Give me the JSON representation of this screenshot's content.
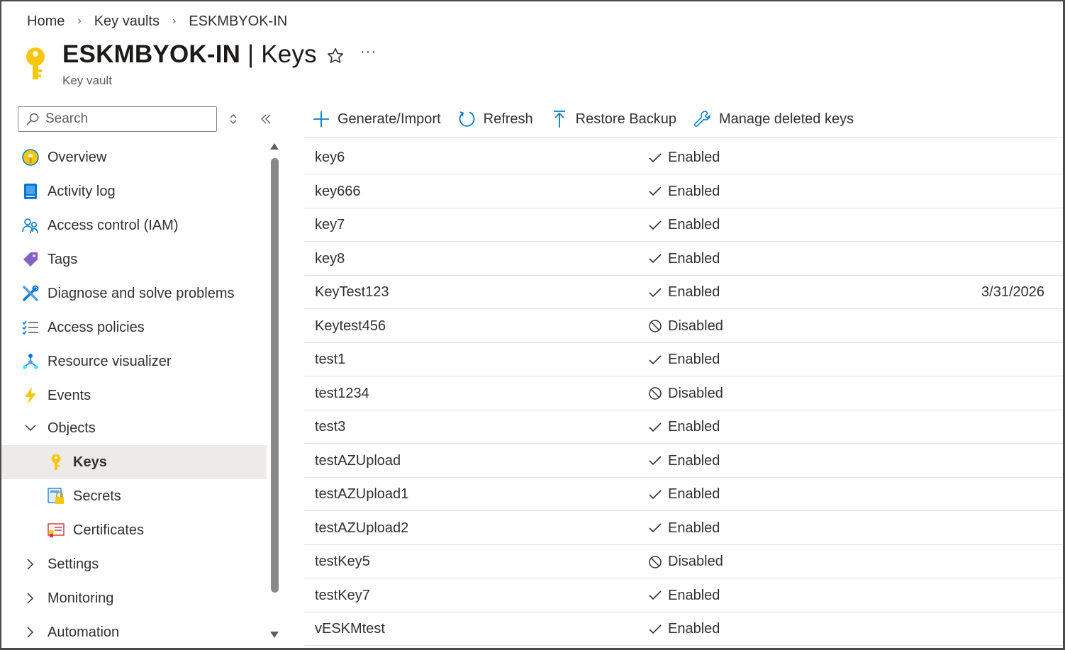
{
  "breadcrumb": [
    {
      "label": "Home"
    },
    {
      "label": "Key vaults"
    },
    {
      "label": "ESKMBYOK-IN"
    }
  ],
  "header": {
    "title_resource": "ESKMBYOK-IN",
    "title_separator": " | ",
    "title_section": "Keys",
    "subtitle": "Key vault",
    "favorite_icon": "star-outline-icon",
    "more_label": "···"
  },
  "nav": {
    "search_placeholder": "Search",
    "items": [
      {
        "label": "Overview",
        "icon": "overview-icon"
      },
      {
        "label": "Activity log",
        "icon": "activity-log-icon"
      },
      {
        "label": "Access control (IAM)",
        "icon": "iam-icon"
      },
      {
        "label": "Tags",
        "icon": "tag-icon"
      },
      {
        "label": "Diagnose and solve problems",
        "icon": "wrench-icon"
      },
      {
        "label": "Access policies",
        "icon": "checklist-icon"
      },
      {
        "label": "Resource visualizer",
        "icon": "hierarchy-icon"
      },
      {
        "label": "Events",
        "icon": "lightning-icon"
      },
      {
        "label": "Objects",
        "icon": "chevron-down-icon"
      },
      {
        "label": "Keys",
        "icon": "key-icon",
        "active": true
      },
      {
        "label": "Secrets",
        "icon": "secret-icon"
      },
      {
        "label": "Certificates",
        "icon": "certificate-icon"
      },
      {
        "label": "Settings",
        "icon": "chevron-right-icon"
      },
      {
        "label": "Monitoring",
        "icon": "chevron-right-icon"
      },
      {
        "label": "Automation",
        "icon": "chevron-right-icon"
      }
    ]
  },
  "toolbar": {
    "generate_label": "Generate/Import",
    "refresh_label": "Refresh",
    "restore_label": "Restore Backup",
    "manage_deleted_label": "Manage deleted keys"
  },
  "keys": [
    {
      "name": "key6",
      "status": "Enabled",
      "expiration": ""
    },
    {
      "name": "key666",
      "status": "Enabled",
      "expiration": ""
    },
    {
      "name": "key7",
      "status": "Enabled",
      "expiration": ""
    },
    {
      "name": "key8",
      "status": "Enabled",
      "expiration": ""
    },
    {
      "name": "KeyTest123",
      "status": "Enabled",
      "expiration": "3/31/2026"
    },
    {
      "name": "Keytest456",
      "status": "Disabled",
      "expiration": ""
    },
    {
      "name": "test1",
      "status": "Enabled",
      "expiration": ""
    },
    {
      "name": "test1234",
      "status": "Disabled",
      "expiration": ""
    },
    {
      "name": "test3",
      "status": "Enabled",
      "expiration": ""
    },
    {
      "name": "testAZUpload",
      "status": "Enabled",
      "expiration": ""
    },
    {
      "name": "testAZUpload1",
      "status": "Enabled",
      "expiration": ""
    },
    {
      "name": "testAZUpload2",
      "status": "Enabled",
      "expiration": ""
    },
    {
      "name": "testKey5",
      "status": "Disabled",
      "expiration": ""
    },
    {
      "name": "testKey7",
      "status": "Enabled",
      "expiration": ""
    },
    {
      "name": "vESKMtest",
      "status": "Enabled",
      "expiration": ""
    }
  ],
  "colors": {
    "accent": "#0078d4",
    "key_yellow": "#f8c60f",
    "active_bg": "#edebe9"
  }
}
